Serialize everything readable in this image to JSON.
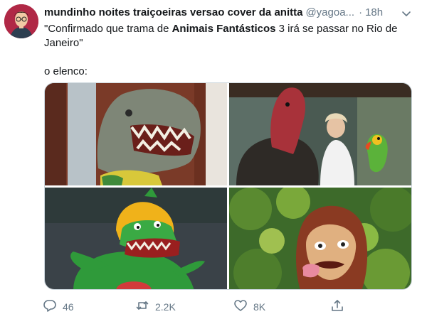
{
  "tweet": {
    "display_name": "mundinho noites traiçoeiras versao cover da anitta",
    "handle": "@yagoa...",
    "separator": "·",
    "time": "18h",
    "text_line1_pre": "\"Confirmado que trama de ",
    "text_line1_bold": "Animais Fantásticos",
    "text_line1_post": " 3 irá se passar no Rio de",
    "text_line2": "Janeiro\"",
    "text_line3": "o elenco:"
  },
  "icons": {
    "avatar": "avatar-photo",
    "menu": "chevron-down-icon",
    "reply": "reply-icon",
    "retweet": "retweet-icon",
    "like": "heart-icon",
    "share": "share-icon"
  },
  "actions": {
    "reply_count": "46",
    "retweet_count": "2.2K",
    "like_count": "8K"
  },
  "colors": {
    "text_primary": "#14171a",
    "text_secondary": "#657786",
    "border": "#ccd6dd"
  }
}
